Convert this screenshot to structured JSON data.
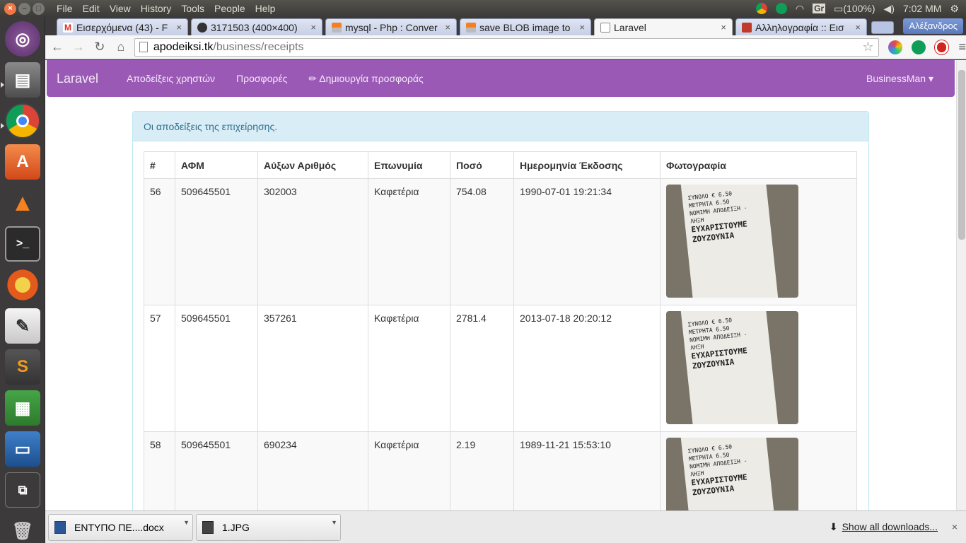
{
  "system": {
    "menus": [
      "File",
      "Edit",
      "View",
      "History",
      "Tools",
      "People",
      "Help"
    ],
    "battery": "(100%)",
    "clock": "7:02 MM",
    "indicator_text": "Gr"
  },
  "launcher": {
    "apps": [
      "ubuntu-dash",
      "files",
      "chrome",
      "software-center",
      "vlc",
      "terminal",
      "help",
      "text-editor",
      "sublime-text",
      "calc",
      "impress",
      "workspace-switcher",
      "trash"
    ]
  },
  "tabs": [
    {
      "title": "Εισερχόμενα (43) - F",
      "icon": "gmail-icon"
    },
    {
      "title": "3171503 (400×400)",
      "icon": "github-icon"
    },
    {
      "title": "mysql - Php : Conver",
      "icon": "stackoverflow-icon"
    },
    {
      "title": "save BLOB image to",
      "icon": "stackoverflow-icon"
    },
    {
      "title": "Laravel",
      "icon": "page-icon"
    },
    {
      "title": "Αλληλογραφία :: Εισ",
      "icon": "mail-icon"
    }
  ],
  "profile": "Αλέξανδρος",
  "address": {
    "host": "apodeiksi.tk",
    "path": "/business/receipts"
  },
  "navbar": {
    "brand": "Laravel",
    "links": [
      "Αποδείξεις χρηστών",
      "Προσφορές",
      "✏ Δημιουργία προσφοράς"
    ],
    "user": "BusinessMan ▾"
  },
  "panel": {
    "heading": "Οι αποδείξεις της επιχείρησης.",
    "columns": [
      "#",
      "ΑΦΜ",
      "Αύξων Αριθμός",
      "Επωνυμία",
      "Ποσό",
      "Ημερομηνία Έκδοσης",
      "Φωτογραφία"
    ],
    "rows": [
      [
        "56",
        "509645501",
        "302003",
        "Καφετέρια",
        "754.08",
        "1990-07-01 19:21:34"
      ],
      [
        "57",
        "509645501",
        "357261",
        "Καφετέρια",
        "2781.4",
        "2013-07-18 20:20:12"
      ],
      [
        "58",
        "509645501",
        "690234",
        "Καφετέρια",
        "2.19",
        "1989-11-21 15:53:10"
      ]
    ]
  },
  "receipt_photo": {
    "lines": [
      "ΣΥΝΟΛΟ € 6.50",
      "ΜΕΤΡΗΤΑ 6.50",
      "ΝΟΜΙΜΗ ΑΠΟΔΕΙΞΗ - ΛΗΞΗ",
      "ΕΥΧΑΡΙΣΤΟΥΜΕ",
      "ΖΟΥΖΟΥΝΙΑ"
    ]
  },
  "downloads": {
    "items": [
      "ΕΝΤΥΠΟ ΠΕ....docx",
      "1.JPG"
    ],
    "show_all": "Show all downloads..."
  }
}
